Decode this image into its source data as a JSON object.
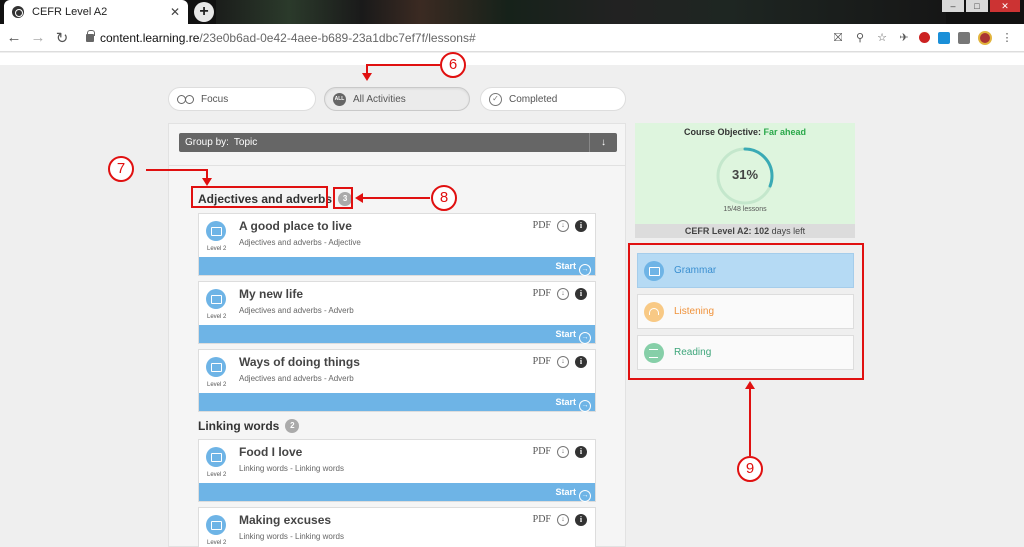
{
  "browser": {
    "tab_title": "CEFR Level A2",
    "tab_close": "✕",
    "new_tab": "+",
    "url_host": "content.learning.re",
    "url_path": "/23e0b6ad-0e42-4aee-b689-23a1dbc7ef7f/lessons#"
  },
  "filters": [
    {
      "label": "Focus",
      "active": false
    },
    {
      "label": "All Activities",
      "active": true,
      "icon_text": "ALL"
    },
    {
      "label": "Completed",
      "active": false
    }
  ],
  "groupby": {
    "label": "Group by:",
    "value": "Topic"
  },
  "topics": [
    {
      "name": "Adjectives and adverbs",
      "count": "3"
    },
    {
      "name": "Linking words",
      "count": "2"
    }
  ],
  "lessons": [
    {
      "title": "A good place to live",
      "subtitle": "Adjectives and adverbs - Adjective",
      "level": "Level 2",
      "pdf": "PDF",
      "start": "Start"
    },
    {
      "title": "My new life",
      "subtitle": "Adjectives and adverbs - Adverb",
      "level": "Level 2",
      "pdf": "PDF",
      "start": "Start"
    },
    {
      "title": "Ways of doing things",
      "subtitle": "Adjectives and adverbs - Adverb",
      "level": "Level 2",
      "pdf": "PDF",
      "start": "Start"
    },
    {
      "title": "Food I love",
      "subtitle": "Linking words - Linking words",
      "level": "Level 2",
      "pdf": "PDF",
      "start": "Start"
    },
    {
      "title": "Making excuses",
      "subtitle": "Linking words - Linking words",
      "level": "Level 2",
      "pdf": "PDF",
      "start": "Start"
    }
  ],
  "objective": {
    "label": "Course Objective:",
    "status": "Far ahead",
    "percent": "31%",
    "progress": 0.31,
    "lessons": "15/48 lessons",
    "course_name": "CEFR Level A2:",
    "days": "102",
    "days_suffix": "days left",
    "ring_color": "#3aaab5"
  },
  "skills": [
    {
      "label": "Grammar",
      "color": "#3a8fd0"
    },
    {
      "label": "Listening",
      "color": "#f0923a"
    },
    {
      "label": "Reading",
      "color": "#3da57a"
    }
  ],
  "annotations": [
    "6",
    "7",
    "8",
    "9"
  ],
  "colors": {
    "annotation": "#e01010",
    "start_bar": "#6eb4e6"
  }
}
